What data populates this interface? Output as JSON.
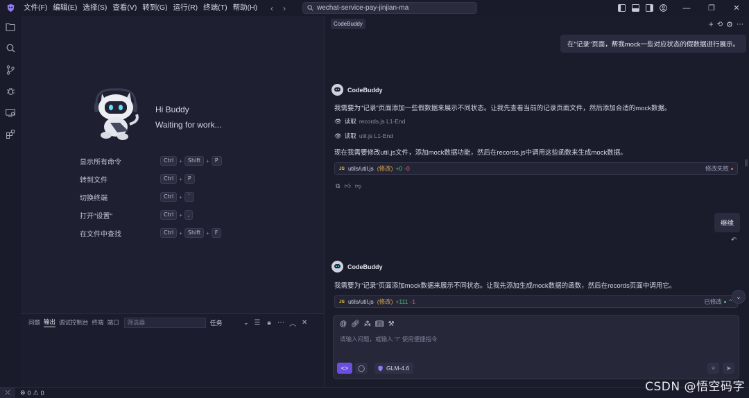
{
  "menu": [
    "文件(F)",
    "编辑(E)",
    "选择(S)",
    "查看(V)",
    "转到(G)",
    "运行(R)",
    "终端(T)",
    "帮助(H)"
  ],
  "search": {
    "value": "wechat-service-pay-jinjian-ma"
  },
  "welcome": {
    "greeting": "Hi Buddy",
    "status": "Waiting for work..."
  },
  "shortcuts": [
    {
      "label": "显示所有命令",
      "keys": [
        "Ctrl",
        "Shift",
        "P"
      ]
    },
    {
      "label": "转到文件",
      "keys": [
        "Ctrl",
        "P"
      ]
    },
    {
      "label": "切换终端",
      "keys": [
        "Ctrl",
        "`"
      ]
    },
    {
      "label": "打开\"设置\"",
      "keys": [
        "Ctrl",
        ","
      ]
    },
    {
      "label": "在文件中查找",
      "keys": [
        "Ctrl",
        "Shift",
        "F"
      ]
    }
  ],
  "panel": {
    "tabs": [
      "问题",
      "输出",
      "调试控制台",
      "终端",
      "端口"
    ],
    "active_tab": "输出",
    "filter_placeholder": "筛选器",
    "task_select": "任务"
  },
  "status": {
    "errors": "0",
    "warnings": "0"
  },
  "chat": {
    "tab": "CodeBuddy",
    "user_message": "在\"记录\"页面，帮我mock一些对应状态的假数据进行展示。",
    "bot_name": "CodeBuddy",
    "bot_msg_1": "我需要为\"记录\"页面添加一些假数据来展示不同状态。让我先查看当前的记录页面文件，然后添加合适的mock数据。",
    "read_1": {
      "action": "读取",
      "file": "records.js L1-End"
    },
    "read_2": {
      "action": "读取",
      "file": "util.js L1-End"
    },
    "bot_msg_2": "现在我需要修改util.js文件，添加mock数据功能，然后在records.js中调用这些函数来生成mock数据。",
    "card_1": {
      "badge": "JS",
      "path": "utils/util.js",
      "mod": "(修改)",
      "add": "+0",
      "del": "-0",
      "status": "修改失败"
    },
    "continue_label": "继续",
    "bot_msg_3": "我需要为\"记录\"页面添加mock数据来展示不同状态。让我先添加生成mock数据的函数，然后在records页面中调用它。",
    "card_2": {
      "badge": "JS",
      "path": "utils/util.js",
      "mod": "(修改)",
      "add": "+111",
      "del": "-1",
      "status": "已修改"
    },
    "input_placeholder": "请输入问题，或输入 \"/\" 使用便捷指令",
    "model": "GLM-4.6"
  },
  "watermark": "CSDN @悟空码字",
  "colors": {
    "accent": "#6b4fe0",
    "added": "#53c27b",
    "deleted": "#e56666",
    "modified": "#e1a84a"
  }
}
